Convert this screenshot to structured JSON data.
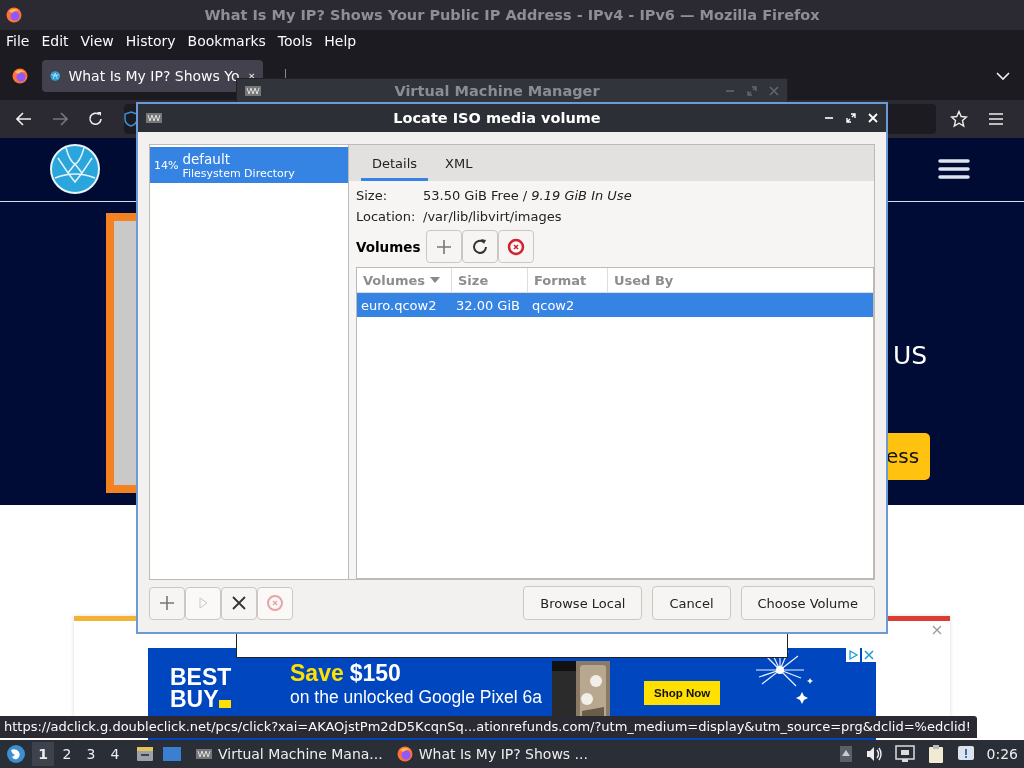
{
  "firefox": {
    "title": "What Is My IP? Shows Your Public IP Address - IPv4 - IPv6 — Mozilla Firefox",
    "menu": [
      "File",
      "Edit",
      "View",
      "History",
      "Bookmarks",
      "Tools",
      "Help"
    ],
    "tabs": [
      {
        "label": "What Is My IP? Shows Yo",
        "selected": true
      }
    ],
    "nav": {
      "back_disabled": false,
      "forward_disabled": true
    },
    "page": {
      "hero_text": "US",
      "hero_button": "ess",
      "ad": {
        "brand_top": "BEST",
        "brand_bottom": "BUY",
        "offer_label": "Save",
        "offer_price": "$150",
        "line_1": "on the unlocked Google Pixel 6a",
        "button": "Shop Now"
      }
    },
    "status_link": "https://adclick.g.doubleclick.net/pcs/click?xai=AKAOjstPm2dD5KcqnSq...ationrefunds.com/?utm_medium=display&utm_source=prg&dclid=%edclid!"
  },
  "vmm_window": {
    "title": "Virtual Machine Manager"
  },
  "dialog": {
    "title": "Locate ISO media volume",
    "pools": [
      {
        "usage": "14%",
        "name": "default",
        "type": "Filesystem Directory",
        "selected": true
      }
    ],
    "tabs": [
      {
        "label": "Details",
        "selected": true
      },
      {
        "label": "XML",
        "selected": false
      }
    ],
    "size_label": "Size:",
    "size_value": "53.50 GiB Free / *9.19 GiB In Use*",
    "location_label": "Location:",
    "location_value": "/var/lib/libvirt/images",
    "volumes_label": "Volumes",
    "volume_tools": [
      {
        "kind": "add",
        "disabled": false
      },
      {
        "kind": "refresh",
        "disabled": false
      },
      {
        "kind": "delete",
        "disabled": false
      }
    ],
    "columns": [
      {
        "label": "Volumes",
        "sorted": true
      },
      {
        "label": "Size",
        "sorted": false
      },
      {
        "label": "Format",
        "sorted": false
      },
      {
        "label": "Used By",
        "sorted": false
      }
    ],
    "rows": [
      {
        "cells": [
          "euro.qcow2",
          "32.00 GiB",
          "qcow2"
        ],
        "selected": true
      }
    ],
    "pool_tools": [
      {
        "kind": "add",
        "disabled": false
      },
      {
        "kind": "start",
        "disabled": true
      },
      {
        "kind": "delete",
        "disabled": false
      },
      {
        "kind": "stop",
        "disabled": true
      }
    ],
    "buttons": [
      "Browse Local",
      "Cancel",
      "Choose Volume"
    ]
  },
  "taskbar": {
    "workspaces": [
      {
        "label": "1",
        "selected": true
      },
      {
        "label": "2",
        "selected": false
      },
      {
        "label": "3",
        "selected": false
      },
      {
        "label": "4",
        "selected": false
      }
    ],
    "tasks": [
      {
        "kind": "vmm",
        "label": "Virtual Machine Mana..."
      },
      {
        "kind": "firefox",
        "label": "What Is My IP? Shows ..."
      }
    ],
    "clock": "0:26"
  }
}
